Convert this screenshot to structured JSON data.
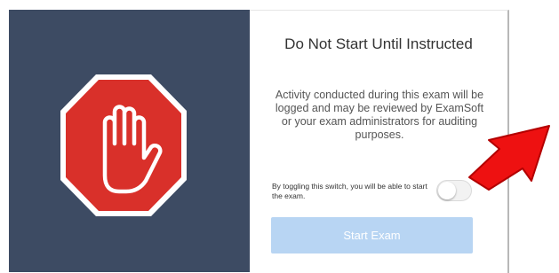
{
  "dialog": {
    "title": "Do Not Start Until Instructed",
    "notice": "Activity conducted during this exam will be logged and may be reviewed by ExamSoft or your exam administrators for auditing purposes.",
    "toggle": {
      "label": "By toggling this switch, you will be able to start the exam.",
      "state": "off"
    },
    "start_button_label": "Start Exam",
    "start_button_enabled": false
  },
  "icons": {
    "stop": "stop-hand-icon",
    "arrow": "red-arrow-pointer"
  },
  "colors": {
    "left_panel": "#3d4b63",
    "stop_sign": "#d9302a",
    "button_disabled": "#b8d5f3",
    "arrow": "#ee1111"
  }
}
